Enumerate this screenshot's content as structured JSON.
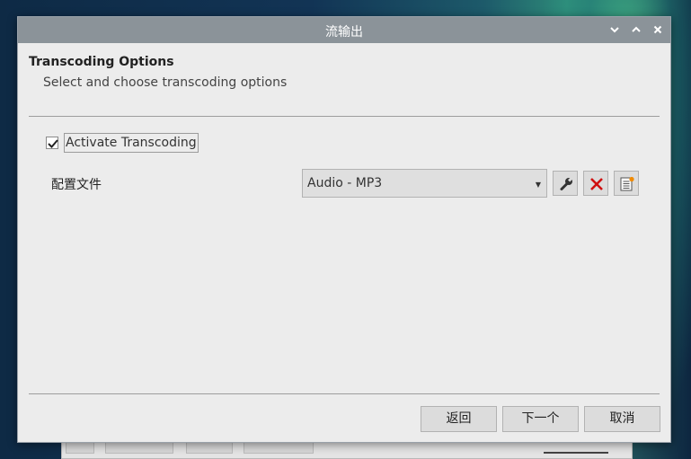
{
  "window": {
    "title": "流输出",
    "controls": [
      "chevron-down-icon",
      "chevron-up-icon",
      "close-icon"
    ]
  },
  "page": {
    "heading": "Transcoding Options",
    "subheading": "Select and choose transcoding options"
  },
  "transcoding": {
    "activate_label": "Activate Transcoding",
    "activate_checked": true
  },
  "profile": {
    "label": "配置文件",
    "selected": "Audio - MP3",
    "buttons": [
      "wrench-icon",
      "delete-icon",
      "new-profile-icon"
    ]
  },
  "footer": {
    "back_label": "返回",
    "next_label": "下一个",
    "cancel_label": "取消"
  },
  "colors": {
    "titlebar": "#8b9399",
    "dialog_bg": "#ececec",
    "delete_red": "#d01010",
    "accent_orange": "#f08a00"
  }
}
